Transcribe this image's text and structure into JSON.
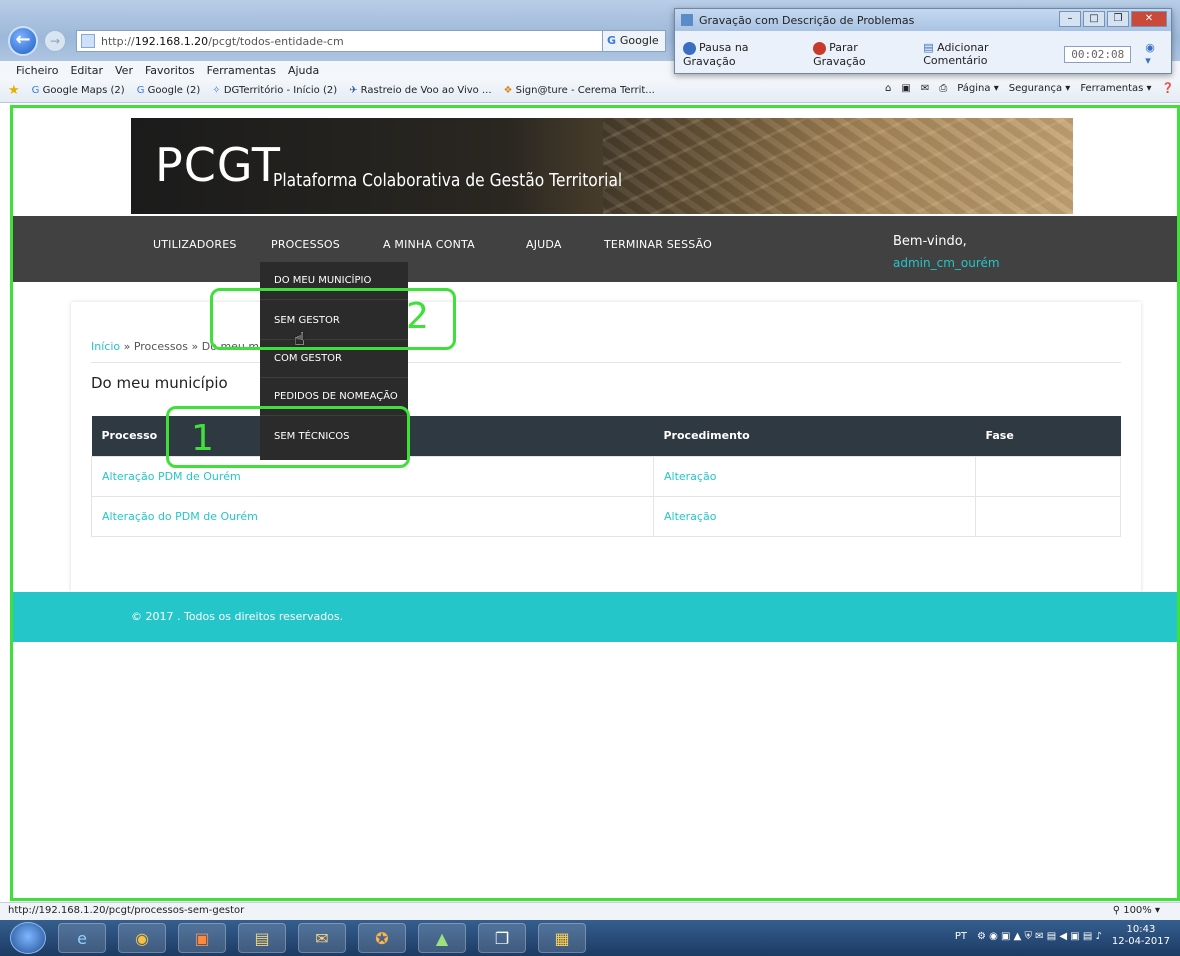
{
  "browser": {
    "url_prefix": "http://",
    "url_host": "192.168.1.20",
    "url_path": "/pcgt/todos-entidade-cm",
    "search_label": "Google",
    "menu": [
      "Ficheiro",
      "Editar",
      "Ver",
      "Favoritos",
      "Ferramentas",
      "Ajuda"
    ],
    "favorites": [
      "Google Maps (2)",
      "Google (2)",
      "DGTerritório - Início (2)",
      "Rastreio de Voo ao Vivo ...",
      "Sign@ture - Cerema Territ..."
    ],
    "commands": [
      "Página ▾",
      "Segurança ▾",
      "Ferramentas ▾"
    ]
  },
  "recorder": {
    "title": "Gravação com Descrição de Problemas",
    "pause": "Pausa na Gravação",
    "stop": "Parar Gravação",
    "comment": "Adicionar Comentário",
    "timer": "00:02:08"
  },
  "site": {
    "logo": "PCGT",
    "subtitle": "Plataforma Colaborativa de Gestão Territorial",
    "nav": [
      "UTILIZADORES",
      "PROCESSOS",
      "A MINHA CONTA",
      "AJUDA",
      "TERMINAR SESSÃO"
    ],
    "welcome": "Bem-vindo,",
    "username": "admin_cm_ourém",
    "dropdown": [
      "DO MEU MUNICÍPIO",
      "SEM GESTOR",
      "COM GESTOR",
      "PEDIDOS DE NOMEAÇÃO",
      "SEM TÉCNICOS"
    ],
    "breadcrumb": {
      "home": "Início",
      "sep1": " » Processos » ",
      "current": "Do meu m"
    },
    "heading": "Do meu município",
    "table": {
      "headers": [
        "Processo",
        "Procedimento",
        "Fase"
      ],
      "rows": [
        [
          "Alteração PDM de Ourém",
          "Alteração",
          ""
        ],
        [
          "Alteração do PDM de Ourém",
          "Alteração",
          ""
        ]
      ]
    },
    "footer": "© 2017 . Todos os direitos reservados."
  },
  "annotations": {
    "one": "1",
    "two": "2"
  },
  "status": {
    "url": "http://192.168.1.20/pcgt/processos-sem-gestor",
    "zoom": "100%"
  },
  "taskbar": {
    "lang": "PT",
    "time": "10:43",
    "date": "12-04-2017"
  },
  "colors": {
    "accent": "#24c6c9",
    "nav_bg": "#414141",
    "dropdown_bg": "#2b2b2b",
    "table_header": "#2f3942",
    "annotation": "#3fe03a"
  }
}
